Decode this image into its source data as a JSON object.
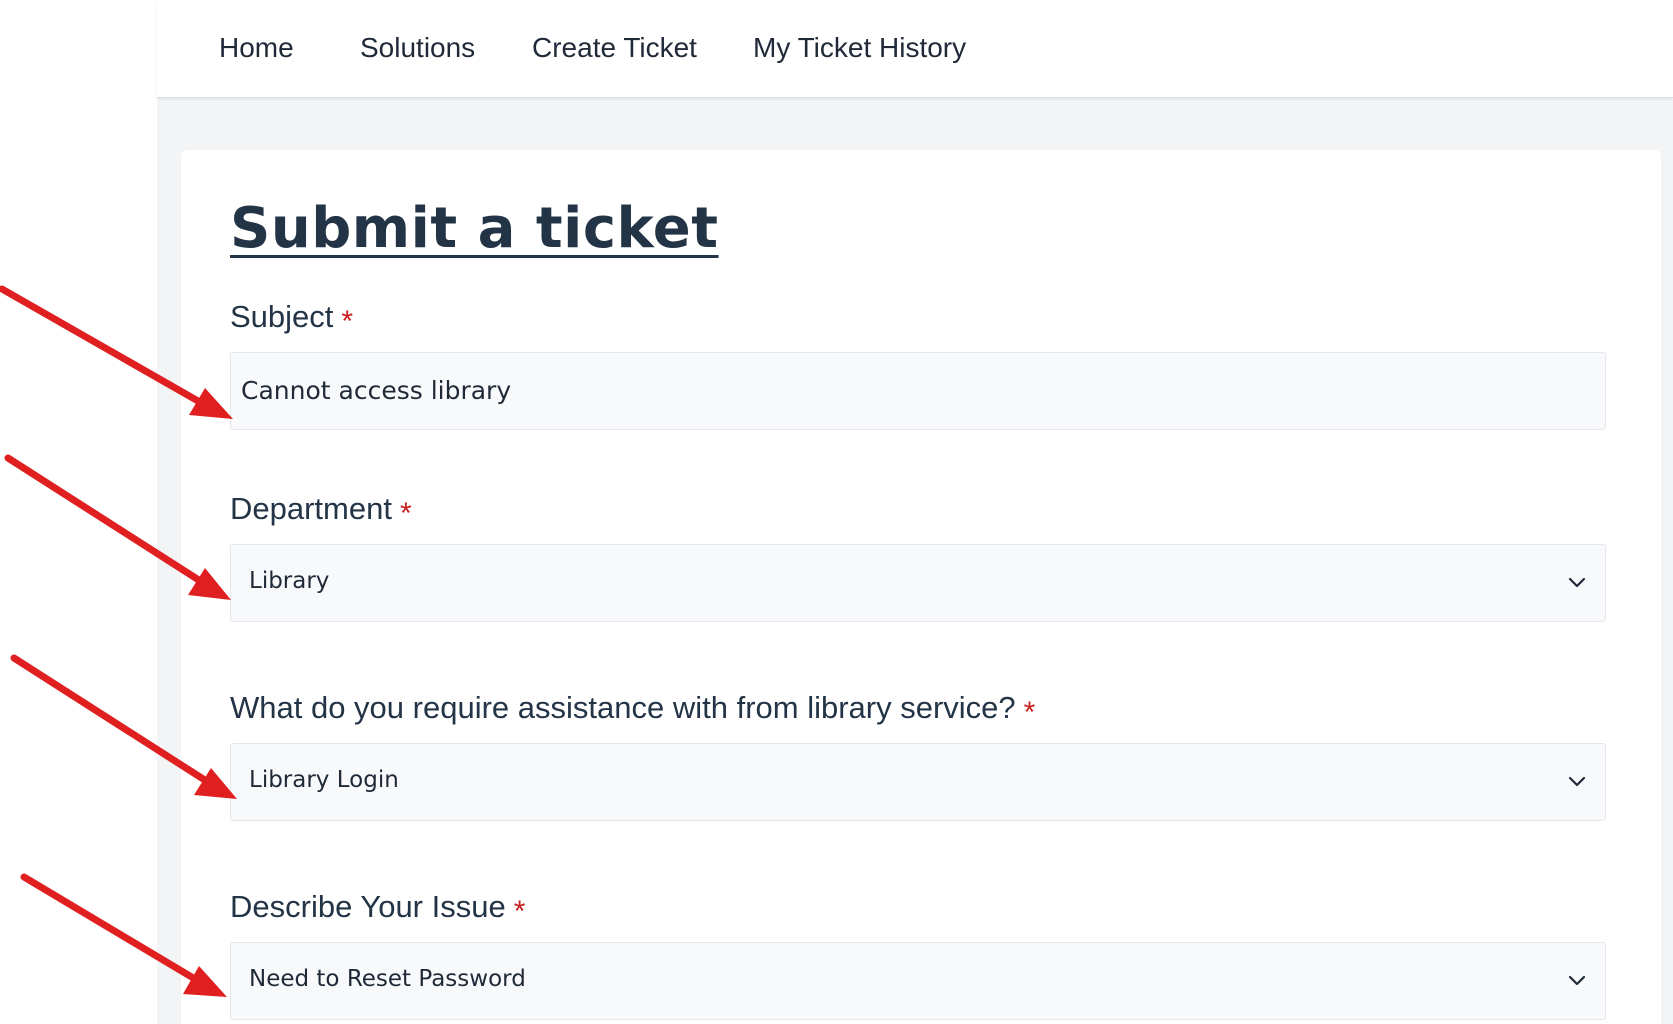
{
  "nav": {
    "items": [
      {
        "label": "Home"
      },
      {
        "label": "Solutions"
      },
      {
        "label": "Create Ticket"
      },
      {
        "label": "My Ticket History"
      }
    ]
  },
  "form": {
    "title": "Submit a ticket",
    "required_marker": "*",
    "subject": {
      "label": "Subject",
      "value": "Cannot access library"
    },
    "department": {
      "label": "Department",
      "selected": "Library"
    },
    "assistance": {
      "label": "What do you require assistance with from library service?",
      "selected": "Library Login"
    },
    "issue": {
      "label": "Describe Your Issue",
      "selected": "Need to Reset Password"
    }
  },
  "annotations": {
    "arrow_color": "#e02020"
  },
  "icons": {
    "dropdown": "chevron-down-icon"
  }
}
